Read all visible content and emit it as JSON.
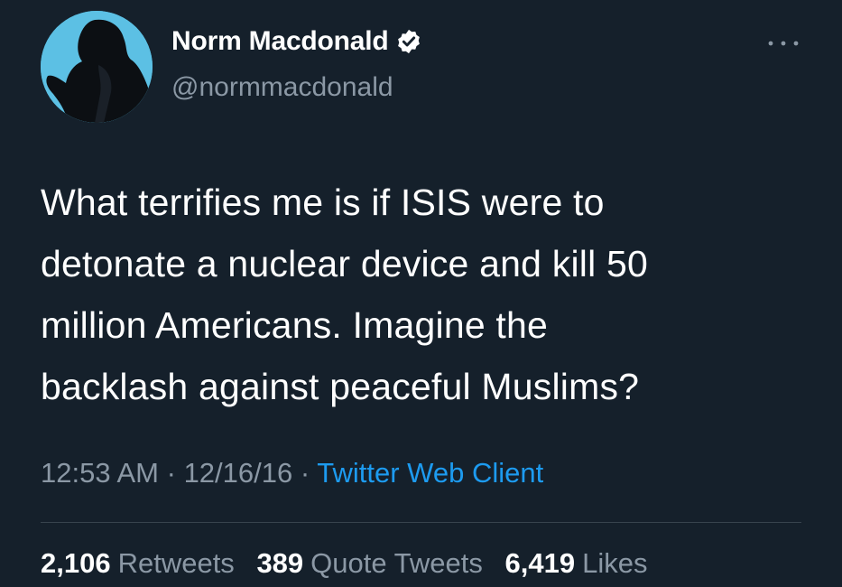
{
  "user": {
    "display_name": "Norm Macdonald",
    "handle": "@normmacdonald",
    "verified_icon": "verified-badge-icon"
  },
  "tweet": {
    "text": "What terrifies me is if ISIS were to\ndetonate a nuclear device and kill 50\nmillion Americans. Imagine the\nbacklash against peaceful Muslims?",
    "time": "12:53 AM",
    "date": "12/16/16",
    "separator": "·",
    "client": "Twitter Web Client"
  },
  "stats": {
    "retweets_count": "2,106",
    "retweets_label": "Retweets",
    "quotes_count": "389",
    "quotes_label": "Quote Tweets",
    "likes_count": "6,419",
    "likes_label": "Likes"
  },
  "colors": {
    "background": "#15202b",
    "secondary_text": "#8b98a5",
    "link": "#1d9bf0",
    "divider": "#38444d"
  }
}
